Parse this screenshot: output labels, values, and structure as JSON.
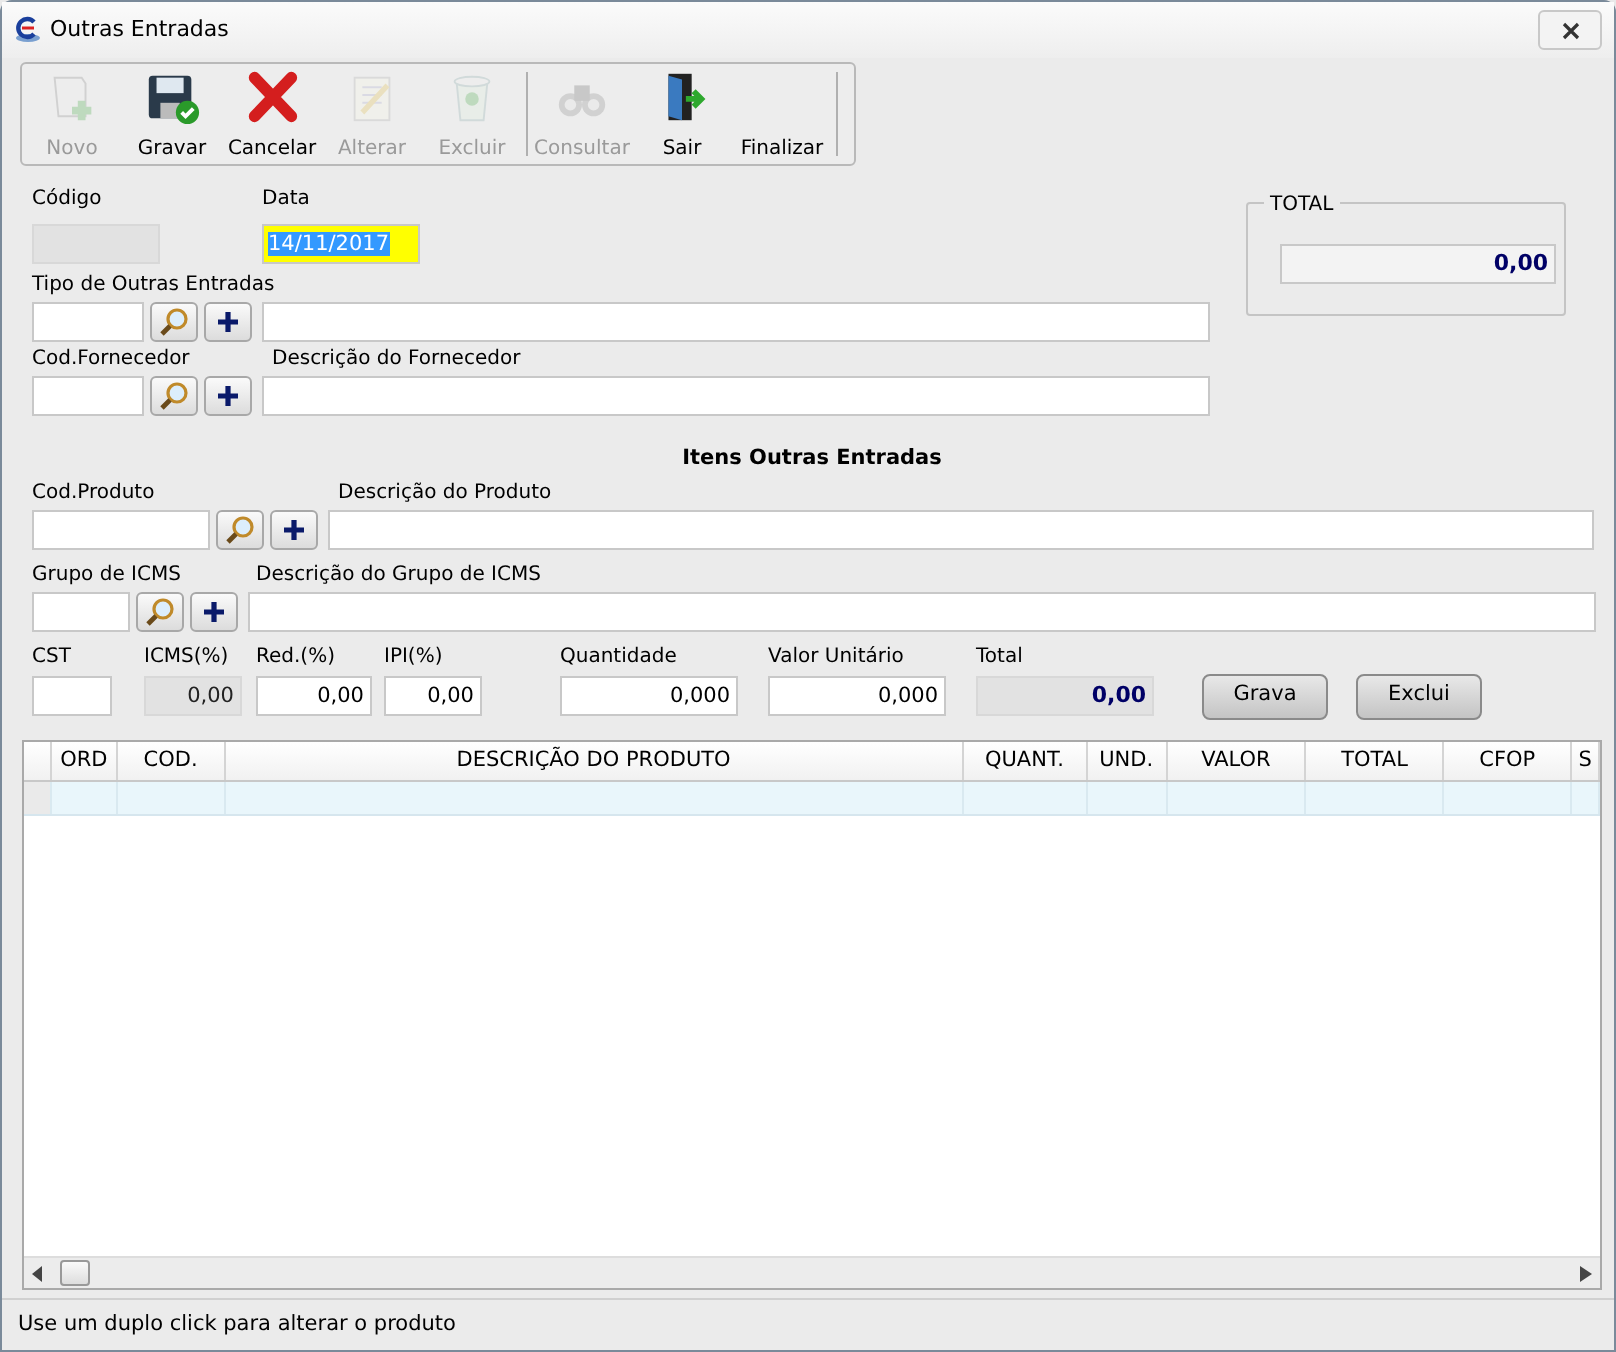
{
  "window": {
    "title": "Outras Entradas"
  },
  "toolbar": [
    {
      "label": "Novo",
      "kind": "new",
      "disabled": true
    },
    {
      "label": "Gravar",
      "kind": "save",
      "disabled": false
    },
    {
      "label": "Cancelar",
      "kind": "cancel",
      "disabled": false
    },
    {
      "label": "Alterar",
      "kind": "edit",
      "disabled": true
    },
    {
      "label": "Excluir",
      "kind": "trash",
      "disabled": true
    },
    {
      "label": "Consultar",
      "kind": "binoculars",
      "disabled": true,
      "separator_before": true
    },
    {
      "label": "Sair",
      "kind": "exit",
      "disabled": false
    },
    {
      "label": "Finalizar",
      "kind": "text",
      "disabled": false
    }
  ],
  "header": {
    "codigo": {
      "label": "Código",
      "disabled": true
    },
    "data": {
      "label": "Data",
      "value": "14/11/2017",
      "focused": true
    }
  },
  "lookups": [
    {
      "code_label": "Tipo de Outras Entradas"
    },
    {
      "code_label": "Cod.Fornecedor",
      "desc_label": "Descrição do Fornecedor"
    }
  ],
  "total_box": {
    "title": "TOTAL",
    "value": "0,00"
  },
  "items_title": "Itens Outras Entradas",
  "item_lookups": [
    {
      "code_label": "Cod.Produto",
      "desc_label": "Descrição do Produto"
    },
    {
      "code_label": "Grupo de ICMS",
      "desc_label": "Descrição do Grupo de ICMS"
    }
  ],
  "item_fields": [
    {
      "label": "CST",
      "disabled": false
    },
    {
      "label": "ICMS(%)",
      "value": "0,00",
      "disabled": true
    },
    {
      "label": "Red.(%)",
      "value": "0,00",
      "disabled": false
    },
    {
      "label": "IPI(%)",
      "value": "0,00",
      "disabled": false
    },
    {
      "label": "Quantidade",
      "value": "0,000",
      "disabled": false
    },
    {
      "label": "Valor Unitário",
      "value": "0,000",
      "disabled": false
    },
    {
      "label": "Total",
      "value": "0,00",
      "disabled": true,
      "emphasis": true
    }
  ],
  "item_buttons": [
    "Grava",
    "Exclui"
  ],
  "grid": {
    "columns": [
      "ORD",
      "COD.",
      "DESCRIÇÃO DO PRODUTO",
      "QUANT.",
      "UND.",
      "VALOR",
      "TOTAL",
      "CFOP",
      "S"
    ]
  },
  "status_bar": "Use um duplo click para alterar o produto"
}
